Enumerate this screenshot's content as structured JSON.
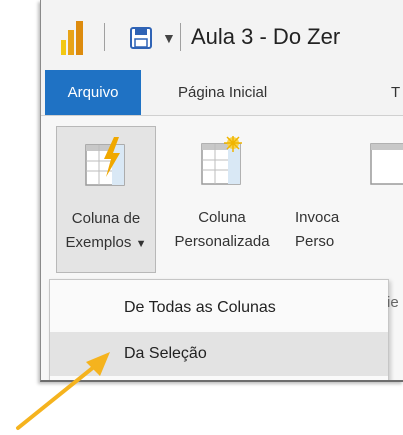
{
  "window": {
    "title": "Aula 3 - Do Zer",
    "logo_icon": "power-bi-logo-icon",
    "save_icon": "save-icon",
    "quick_access_icon": "chevron-down-icon"
  },
  "tabs": [
    {
      "label": "Arquivo",
      "active": true
    },
    {
      "label": "Página Inicial",
      "active": false
    },
    {
      "label": "T",
      "active": false
    }
  ],
  "ribbon": {
    "buttons": [
      {
        "line1": "Coluna de",
        "line2": "Exemplos",
        "icon": "column-from-examples-icon",
        "dropdown": true
      },
      {
        "line1": "Coluna",
        "line2": "Personalizada",
        "icon": "custom-column-icon"
      },
      {
        "line1": "Invoca",
        "line2": "Perso",
        "icon": "invoke-custom-function-icon"
      }
    ],
    "partial_text": "ie"
  },
  "menu": {
    "items": [
      {
        "label": "De Todas as Colunas",
        "highlighted": false
      },
      {
        "label": "Da Seleção",
        "highlighted": true
      }
    ]
  },
  "colors": {
    "accent": "#1f72c4",
    "arrow": "#f5b31e",
    "logo_yellow": "#f2c811",
    "lightning": "#f0a800"
  },
  "annotation": {
    "icon": "pointer-arrow-icon"
  }
}
